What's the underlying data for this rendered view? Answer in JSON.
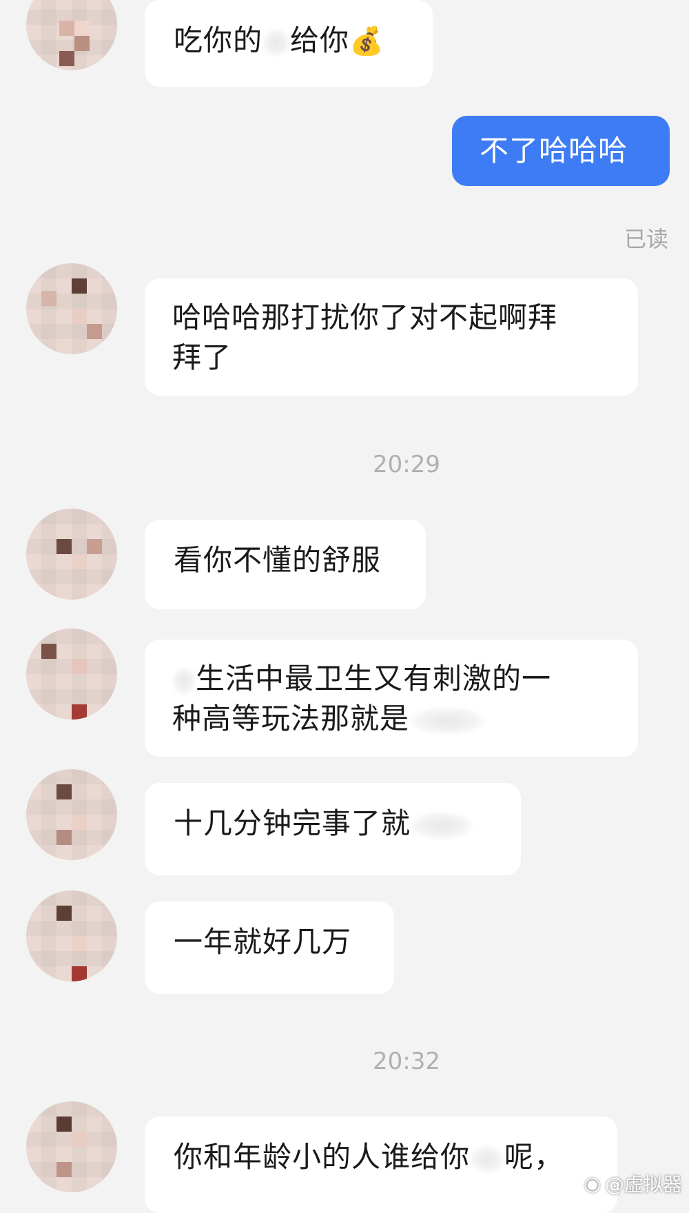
{
  "messages": [
    {
      "side": "left",
      "parts": [
        "吃你的",
        "给你"
      ],
      "emoji": "💰"
    },
    {
      "side": "right",
      "text": "不了哈哈哈"
    },
    {
      "side": "left",
      "lines": [
        "哈哈哈那打扰你了对不起啊拜",
        "拜了"
      ]
    },
    {
      "side": "left",
      "text": "看你不懂的舒服"
    },
    {
      "side": "left",
      "lines": [
        "生活中最卫生又有刺激的一",
        "种高等玩法那就是"
      ]
    },
    {
      "side": "left",
      "text": "十几分钟完事了就"
    },
    {
      "side": "left",
      "text": "一年就好几万"
    },
    {
      "side": "left",
      "parts": [
        "你和年龄小的人谁给你",
        "呢，"
      ]
    }
  ],
  "read_status": "已读",
  "timestamps": [
    "20:29",
    "20:32"
  ],
  "watermark": "@虚拟器"
}
